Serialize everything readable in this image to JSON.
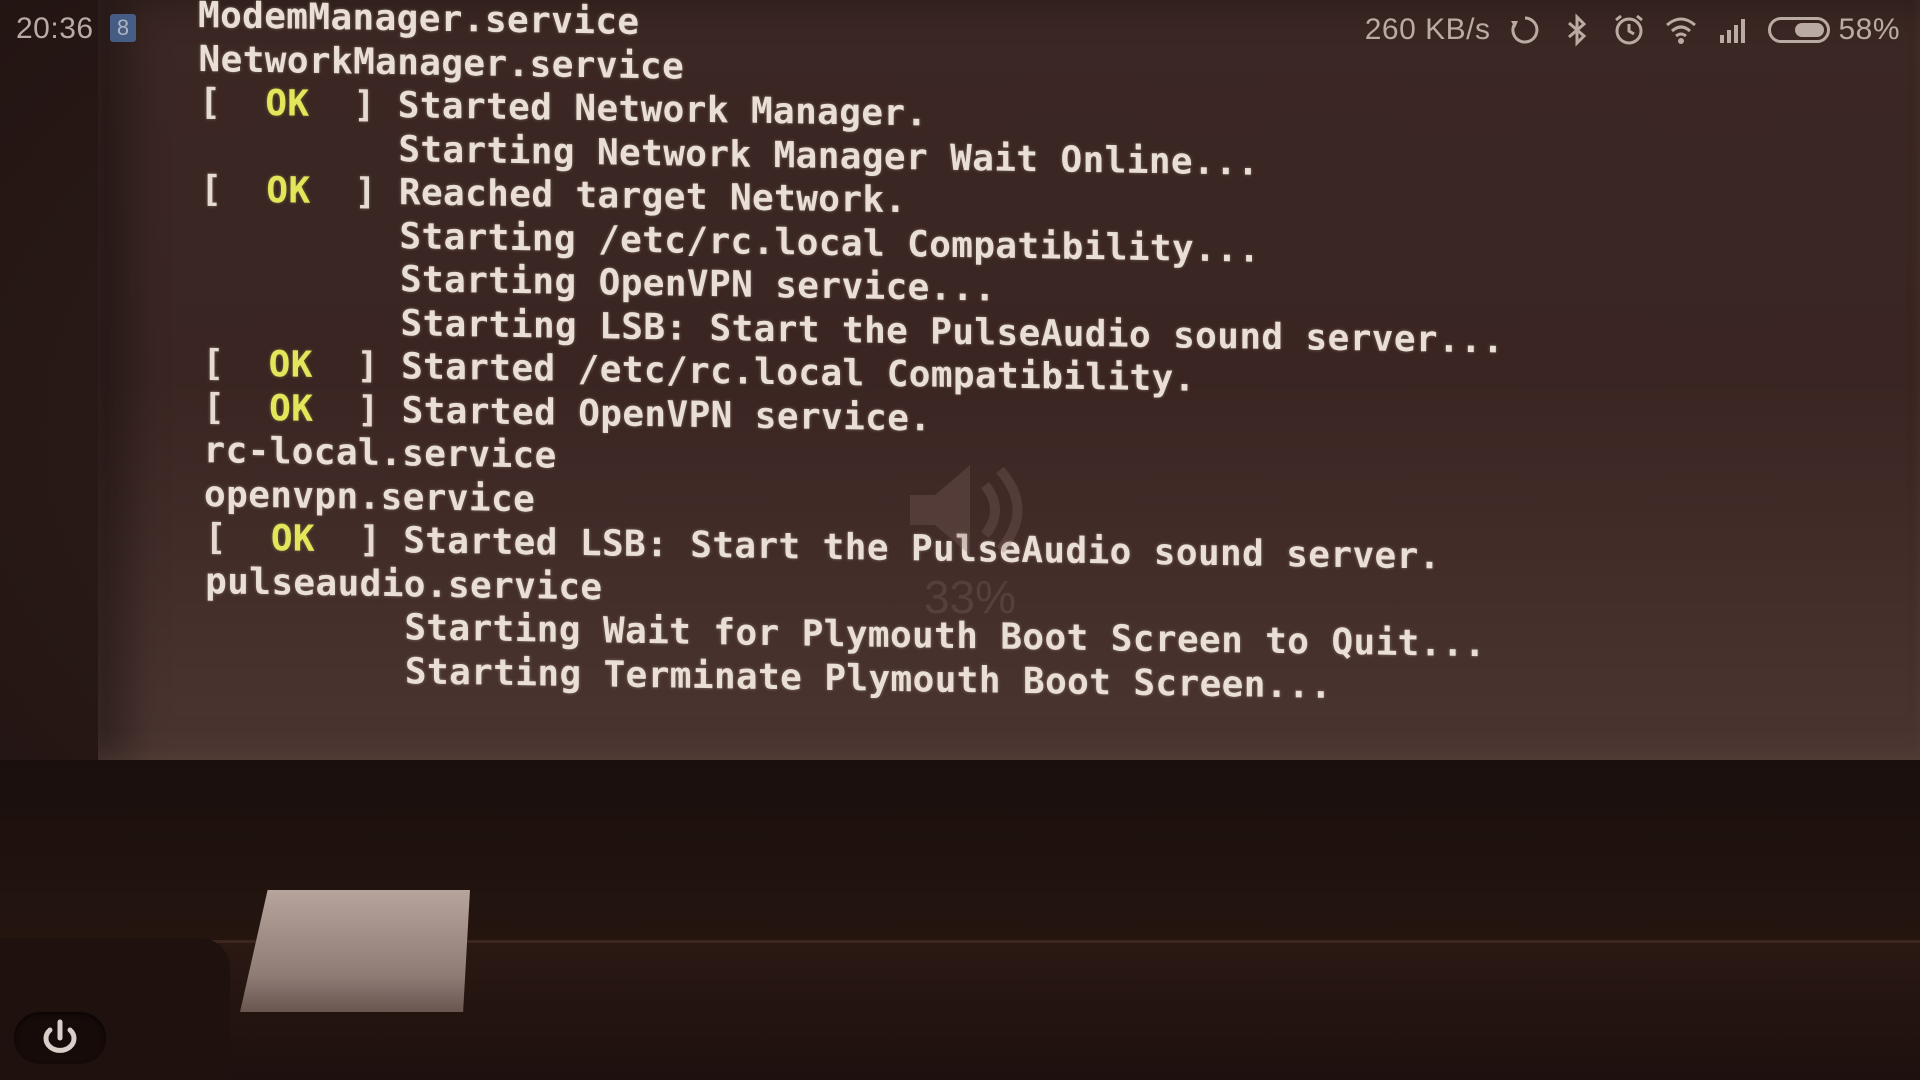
{
  "status_bar": {
    "time": "20:36",
    "notification_glyph": "8",
    "net_speed": "260 KB/s",
    "battery_percent": "58%",
    "battery_level": 0.58,
    "icons": [
      "sync-icon",
      "bluetooth-icon",
      "alarm-icon",
      "wifi-icon",
      "signal-icon",
      "battery-icon"
    ]
  },
  "terminal": {
    "lines": [
      {
        "status": "",
        "text": "ModemManager.service"
      },
      {
        "status": "",
        "text": "NetworkManager.service"
      },
      {
        "status": "OK",
        "text": "Started Network Manager."
      },
      {
        "status": "",
        "indent": true,
        "text": "Starting Network Manager Wait Online..."
      },
      {
        "status": "OK",
        "text": "Reached target Network."
      },
      {
        "status": "",
        "indent": true,
        "text": "Starting /etc/rc.local Compatibility..."
      },
      {
        "status": "",
        "indent": true,
        "text": "Starting OpenVPN service..."
      },
      {
        "status": "",
        "indent": true,
        "text": "Starting LSB: Start the PulseAudio sound server..."
      },
      {
        "status": "OK",
        "text": "Started /etc/rc.local Compatibility."
      },
      {
        "status": "OK",
        "text": "Started OpenVPN service."
      },
      {
        "status": "",
        "text": "rc-local.service"
      },
      {
        "status": "",
        "text": "openvpn.service"
      },
      {
        "status": "OK",
        "text": "Started LSB: Start the PulseAudio sound server."
      },
      {
        "status": "",
        "text": "pulseaudio.service"
      },
      {
        "status": "",
        "indent": true,
        "text": "Starting Wait for Plymouth Boot Screen to Quit..."
      },
      {
        "status": "",
        "indent": true,
        "text": "Starting Terminate Plymouth Boot Screen..."
      }
    ]
  },
  "volume_overlay": {
    "icon": "speaker-icon",
    "level": "33%"
  },
  "colors": {
    "ok": "#e3e55a",
    "text": "#eadfd6",
    "background": "#3a2522"
  }
}
